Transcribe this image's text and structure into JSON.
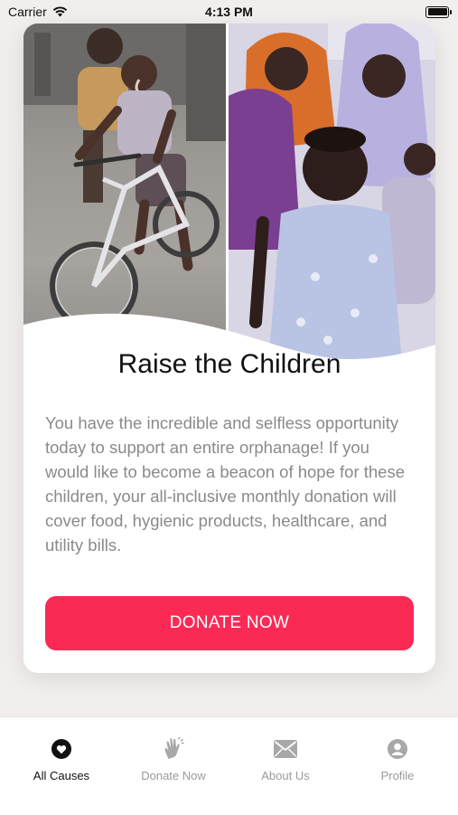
{
  "status_bar": {
    "carrier": "Carrier",
    "time": "4:13 PM",
    "icons": [
      "wifi-icon",
      "battery-icon"
    ]
  },
  "cause_card": {
    "title": "Raise the Children",
    "description": "You have the incredible and selfless opportunity today to support an entire orphanage! If you would like to become a beacon of hope for these children, your all-inclusive monthly donation will cover food, hygienic products, healthcare, and utility bills.",
    "donate_button": "DONATE NOW"
  },
  "tab_bar": {
    "items": [
      {
        "label": "All Causes",
        "icon": "heart-icon",
        "active": true
      },
      {
        "label": "Donate Now",
        "icon": "clapping-hands-icon",
        "active": false
      },
      {
        "label": "About Us",
        "icon": "envelope-icon",
        "active": false
      },
      {
        "label": "Profile",
        "icon": "person-circle-icon",
        "active": false
      }
    ]
  },
  "colors": {
    "accent": "#fa2a55",
    "background": "#f2eeee",
    "active_tab": "#111111",
    "inactive_tab": "#9a9a9a"
  }
}
